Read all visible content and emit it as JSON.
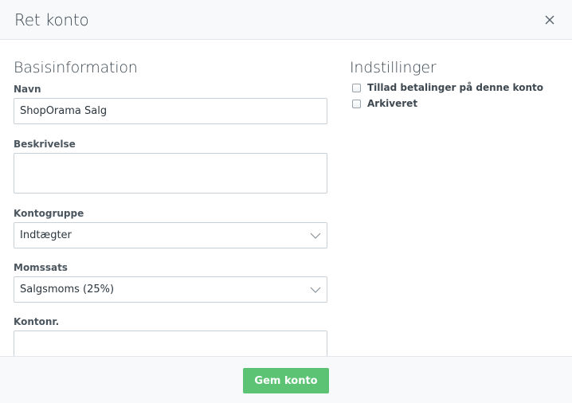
{
  "dialog": {
    "title": "Ret konto",
    "close_icon": "close-icon"
  },
  "basis": {
    "title": "Basisinformation",
    "name_label": "Navn",
    "name_value": "ShopOrama Salg",
    "description_label": "Beskrivelse",
    "description_value": "",
    "group_label": "Kontogruppe",
    "group_value": "Indtægter",
    "vat_label": "Momssats",
    "vat_value": "Salgsmoms (25%)",
    "number_label": "Kontonr.",
    "number_value": ""
  },
  "settings": {
    "title": "Indstillinger",
    "allow_payments_label": "Tillad betalinger på denne konto",
    "allow_payments_checked": false,
    "archived_label": "Arkiveret",
    "archived_checked": false
  },
  "footer": {
    "save_label": "Gem konto",
    "save_color": "#5cc374"
  }
}
